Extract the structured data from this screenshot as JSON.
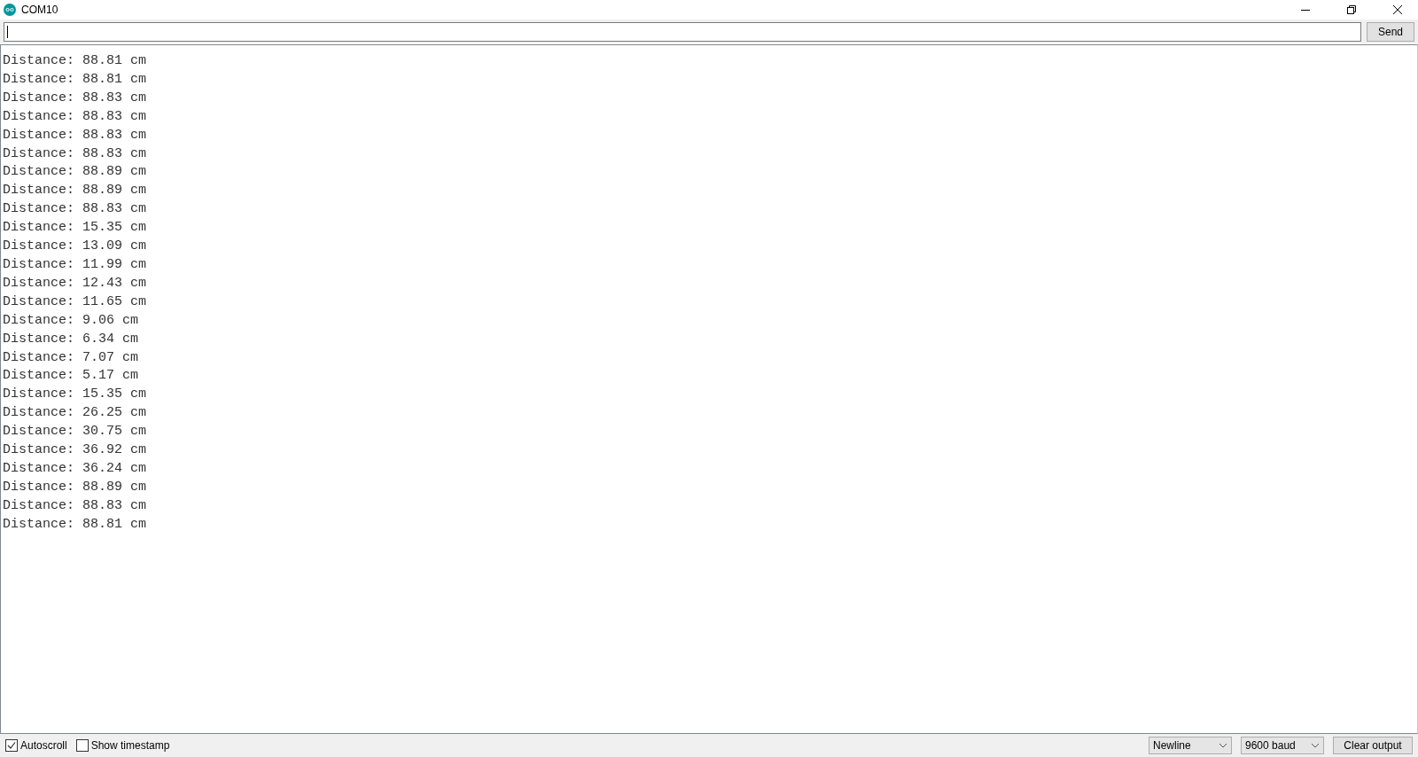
{
  "window": {
    "title": "COM10"
  },
  "send_button": "Send",
  "output_lines": [
    "Distance: 88.81 cm",
    "Distance: 88.81 cm",
    "Distance: 88.83 cm",
    "Distance: 88.83 cm",
    "Distance: 88.83 cm",
    "Distance: 88.83 cm",
    "Distance: 88.89 cm",
    "Distance: 88.89 cm",
    "Distance: 88.83 cm",
    "Distance: 15.35 cm",
    "Distance: 13.09 cm",
    "Distance: 11.99 cm",
    "Distance: 12.43 cm",
    "Distance: 11.65 cm",
    "Distance: 9.06 cm",
    "Distance: 6.34 cm",
    "Distance: 7.07 cm",
    "Distance: 5.17 cm",
    "Distance: 15.35 cm",
    "Distance: 26.25 cm",
    "Distance: 30.75 cm",
    "Distance: 36.92 cm",
    "Distance: 36.24 cm",
    "Distance: 88.89 cm",
    "Distance: 88.83 cm",
    "Distance: 88.81 cm"
  ],
  "status_bar": {
    "checkboxes": [
      {
        "label": "Autoscroll",
        "checked": true
      },
      {
        "label": "Show timestamp",
        "checked": false
      }
    ],
    "line_ending": "Newline",
    "baud_rate": "9600 baud",
    "clear_button": "Clear output"
  }
}
